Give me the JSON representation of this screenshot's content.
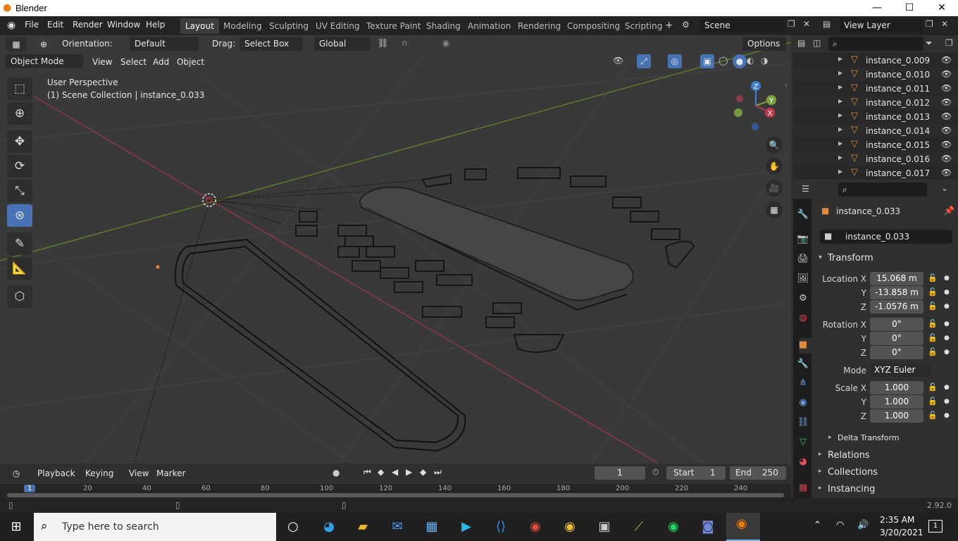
{
  "title_bar": {
    "app_title": "Blender",
    "minimize": "—",
    "maximize": "☐",
    "close": "✕"
  },
  "top_menu": {
    "items": [
      "File",
      "Edit",
      "Render",
      "Window",
      "Help"
    ]
  },
  "workspaces": [
    "Layout",
    "Modeling",
    "Sculpting",
    "UV Editing",
    "Texture Paint",
    "Shading",
    "Animation",
    "Rendering",
    "Compositing",
    "Scripting"
  ],
  "scene": {
    "name": "Scene",
    "view_layer": "View Layer"
  },
  "tool_header": {
    "orientation_label": "Orientation:",
    "orientation_value": "Default",
    "drag_label": "Drag:",
    "drag_value": "Select Box",
    "transform_orientation": "Global",
    "options_label": "Options"
  },
  "viewport_header": {
    "mode": "Object Mode",
    "menus": [
      "View",
      "Select",
      "Add",
      "Object"
    ]
  },
  "viewport": {
    "perspective_label": "User Perspective",
    "collection_label": "(1) Scene Collection | instance_0.033",
    "gizmo": {
      "z": "Z",
      "y": "Y",
      "x": "X"
    }
  },
  "outliner": {
    "items": [
      "instance_0.009",
      "instance_0.010",
      "instance_0.011",
      "instance_0.012",
      "instance_0.013",
      "instance_0.014",
      "instance_0.015",
      "instance_0.016",
      "instance_0.017"
    ]
  },
  "properties": {
    "object_name": "instance_0.033",
    "data_name": "instance_0.033",
    "transform_label": "Transform",
    "location": {
      "label": "Location X",
      "x": "15.068 m",
      "y": "-13.858 m",
      "z": "-1.0576 m"
    },
    "rotation": {
      "label": "Rotation X",
      "x": "0°",
      "y": "0°",
      "z": "0°"
    },
    "mode_label": "Mode",
    "mode_value": "XYZ Euler",
    "scale": {
      "label": "Scale X",
      "x": "1.000",
      "y": "1.000",
      "z": "1.000"
    },
    "axis_y": "Y",
    "axis_z": "Z",
    "delta_transform": "Delta Transform",
    "relations": "Relations",
    "collections": "Collections",
    "instancing": "Instancing"
  },
  "timeline": {
    "menus": [
      "Playback",
      "Keying",
      "View",
      "Marker"
    ],
    "current_frame": "1",
    "start_label": "Start",
    "start_value": "1",
    "end_label": "End",
    "end_value": "250",
    "ruler_marks": [
      "1",
      "20",
      "40",
      "60",
      "80",
      "100",
      "120",
      "140",
      "160",
      "180",
      "200",
      "220",
      "240"
    ]
  },
  "status_bar": {
    "version": "2.92.0"
  },
  "taskbar": {
    "search_placeholder": "Type here to search",
    "time": "2:35 AM",
    "date": "3/20/2021",
    "notifications": "1"
  },
  "colors": {
    "accent": "#4772b3",
    "x_axis": "#c0394b",
    "y_axis": "#7ba23c",
    "z_axis": "#3c7fd6",
    "object_orange": "#e5893a"
  }
}
